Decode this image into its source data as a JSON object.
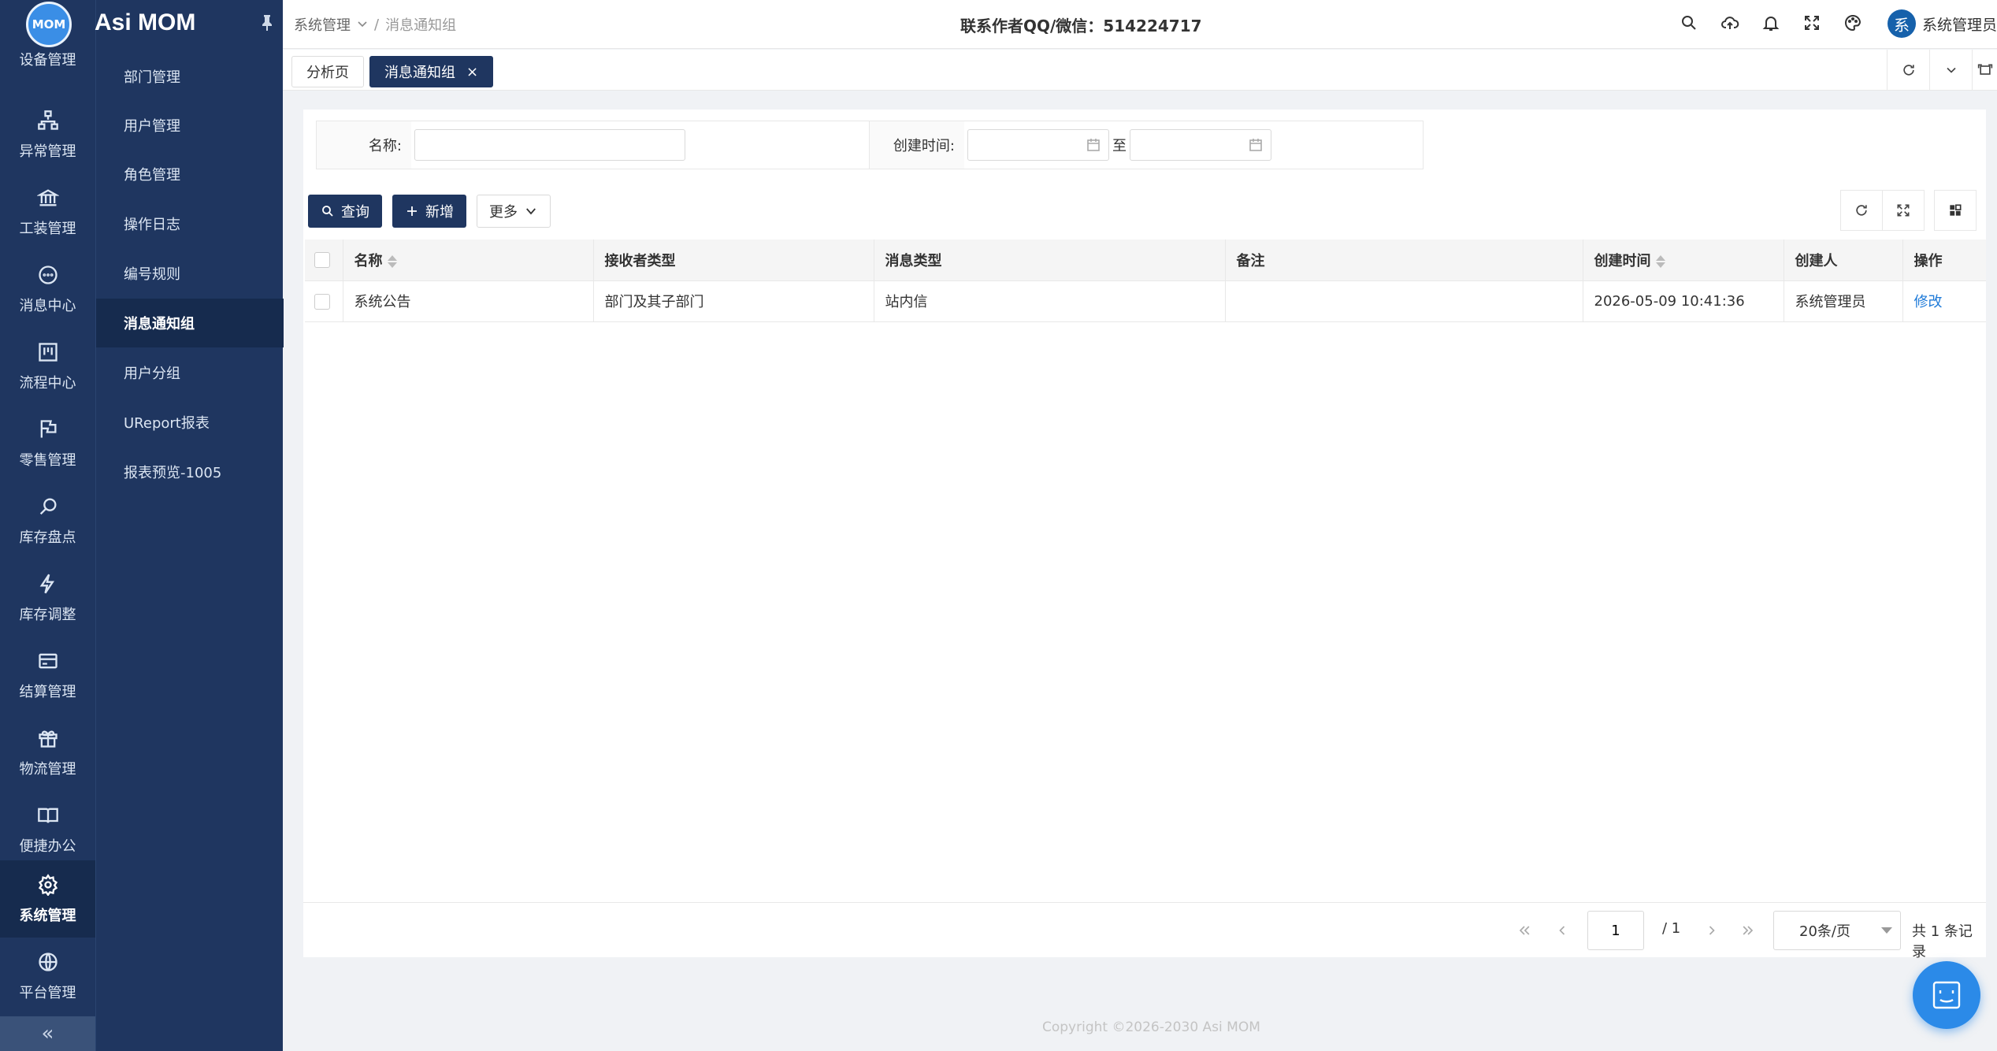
{
  "app": {
    "logo_text": "MOM",
    "brand_title": "Asi MOM"
  },
  "rail": {
    "top_label": "设备管理",
    "items": [
      {
        "label": "异常管理",
        "icon": "sitemap-icon"
      },
      {
        "label": "工装管理",
        "icon": "bank-icon"
      },
      {
        "label": "消息中心",
        "icon": "chat-icon"
      },
      {
        "label": "流程中心",
        "icon": "kanban-icon"
      },
      {
        "label": "零售管理",
        "icon": "flag-icon"
      },
      {
        "label": "库存盘点",
        "icon": "search-icon"
      },
      {
        "label": "库存调整",
        "icon": "bolt-icon"
      },
      {
        "label": "结算管理",
        "icon": "card-icon"
      },
      {
        "label": "物流管理",
        "icon": "gift-icon"
      },
      {
        "label": "便捷办公",
        "icon": "book-icon"
      },
      {
        "label": "系统管理",
        "icon": "gear-icon",
        "active": true
      },
      {
        "label": "平台管理",
        "icon": "globe-icon"
      }
    ],
    "collapse_glyph": "«"
  },
  "submenu": {
    "items": [
      {
        "label": "部门管理"
      },
      {
        "label": "用户管理"
      },
      {
        "label": "角色管理"
      },
      {
        "label": "操作日志"
      },
      {
        "label": "编号规则"
      },
      {
        "label": "消息通知组",
        "active": true
      },
      {
        "label": "用户分组"
      },
      {
        "label": "UReport报表"
      },
      {
        "label": "报表预览-1005"
      }
    ]
  },
  "header": {
    "breadcrumb_root": "系统管理",
    "breadcrumb_sep": "/",
    "breadcrumb_current": "消息通知组",
    "contact": "联系作者QQ/微信：514224717",
    "user_avatar": "系",
    "user_name": "系统管理员"
  },
  "tabs": [
    {
      "label": "分析页"
    },
    {
      "label": "消息通知组",
      "active": true,
      "close": "×"
    }
  ],
  "search": {
    "name_label": "名称:",
    "name_value": "",
    "created_label": "创建时间:",
    "to_label": "至"
  },
  "toolbar": {
    "query_label": "查询",
    "add_label": "新增",
    "more_label": "更多"
  },
  "table": {
    "columns": [
      "名称",
      "接收者类型",
      "消息类型",
      "备注",
      "创建时间",
      "创建人",
      "操作"
    ],
    "rows": [
      {
        "name": "系统公告",
        "receiver_type": "部门及其子部门",
        "msg_type": "站内信",
        "remark": "",
        "created": "2026-05-09 10:41:36",
        "creator": "系统管理员",
        "action": "修改"
      }
    ]
  },
  "pager": {
    "page": "1",
    "total_pages": "/ 1",
    "page_size": "20条/页",
    "total_text": "共 1 条记录"
  },
  "footer": {
    "copyright": "Copyright ©2026-2030 Asi MOM"
  },
  "colors": {
    "sidebar": "#1f3660",
    "primary": "#1f3660",
    "link": "#1e7ad8",
    "fab": "#2b8ae8"
  }
}
